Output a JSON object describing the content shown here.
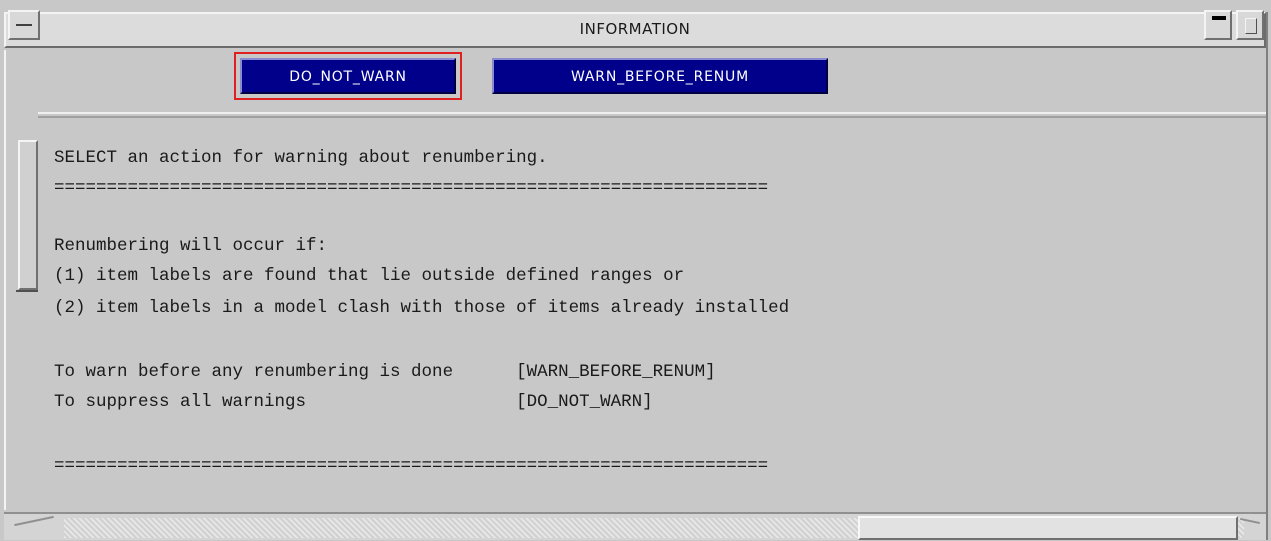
{
  "window": {
    "title": "INFORMATION"
  },
  "buttons": {
    "do_not_warn": "DO_NOT_WARN",
    "warn_before_renum": "WARN_BEFORE_RENUM"
  },
  "panel": {
    "lines": [
      "SELECT an action for warning about renumbering.",
      "====================================================================",
      "Renumbering will occur if:",
      "(1) item labels are found that lie outside defined ranges or",
      "(2) item labels in a model clash with those of items already installed",
      "To warn before any renumbering is done      [WARN_BEFORE_RENUM]",
      "To suppress all warnings                    [DO_NOT_WARN]",
      "===================================================================="
    ]
  },
  "colors": {
    "button_bg": "#00008a",
    "selection_outline": "#e02020",
    "window_bg": "#c8c8c8"
  }
}
